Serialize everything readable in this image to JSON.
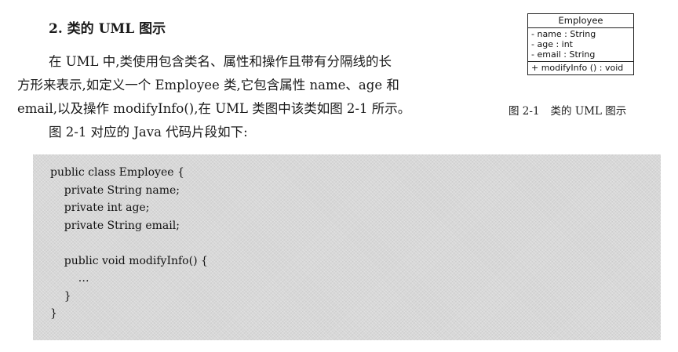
{
  "section": {
    "heading": "2. 类的 UML 图示"
  },
  "paragraph": {
    "lines": [
      "在 UML 中,类使用包含类名、属性和操作且带有分隔线的长",
      "方形来表示,如定义一个 Employee 类,它包含属性 name、age 和",
      "email,以及操作 modifyInfo(),在 UML 类图中该类如图 2-1 所示。",
      "图 2-1 对应的 Java 代码片段如下:"
    ]
  },
  "uml_class": {
    "name": "Employee",
    "attributes": [
      "- name  : String",
      "- age    : int",
      "- email  : String"
    ],
    "operations": [
      "+ modifyInfo () : void"
    ]
  },
  "figure_caption": {
    "number": "图 2-1",
    "text": "类的 UML 图示"
  },
  "code": {
    "lines": [
      "public class Employee {",
      "    private String name;",
      "    private int age;",
      "    private String email;",
      "",
      "    public void modifyInfo() {",
      "        …",
      "    }",
      "}"
    ]
  }
}
